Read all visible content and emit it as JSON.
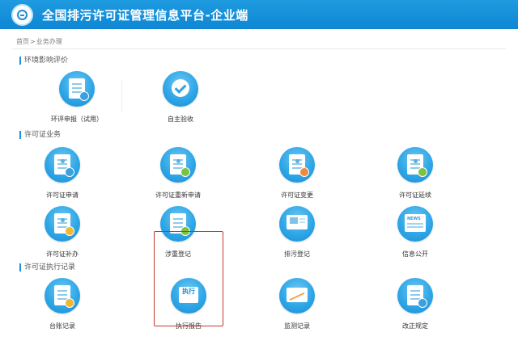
{
  "header": {
    "title": "全国排污许可证管理信息平台-企业端"
  },
  "breadcrumb": {
    "home": "首页",
    "sep": ">",
    "current": "业务办理"
  },
  "sections": {
    "eia": {
      "title": "环境影响评价",
      "items": [
        {
          "label": "环评申报（试用）",
          "icon": "report-icon"
        },
        {
          "label": "自主验收",
          "icon": "acceptance-check-icon"
        }
      ]
    },
    "permit": {
      "title": "许可证业务",
      "items": [
        {
          "label": "许可证申请",
          "icon": "permit-apply-icon"
        },
        {
          "label": "许可证重新申请",
          "icon": "permit-reapply-icon"
        },
        {
          "label": "许可证变更",
          "icon": "permit-change-icon"
        },
        {
          "label": "许可证延续",
          "icon": "permit-renew-icon"
        },
        {
          "label": "许可证补办",
          "icon": "permit-reissue-icon"
        },
        {
          "label": "涉重登记",
          "icon": "heavy-metal-register-icon"
        },
        {
          "label": "排污登记",
          "icon": "discharge-register-icon"
        },
        {
          "label": "信息公开",
          "icon": "news-icon"
        }
      ]
    },
    "execution": {
      "title": "许可证执行记录",
      "items": [
        {
          "label": "台账记录",
          "icon": "ledger-icon"
        },
        {
          "label": "执行报告",
          "icon": "execution-report-icon",
          "icon_text": "执行"
        },
        {
          "label": "监测记录",
          "icon": "monitor-chart-icon"
        },
        {
          "label": "改正规定",
          "icon": "correction-icon"
        }
      ]
    }
  },
  "colors": {
    "header": "#1589d6",
    "accent": "#2ea6e6",
    "highlight": "#c0392b"
  }
}
